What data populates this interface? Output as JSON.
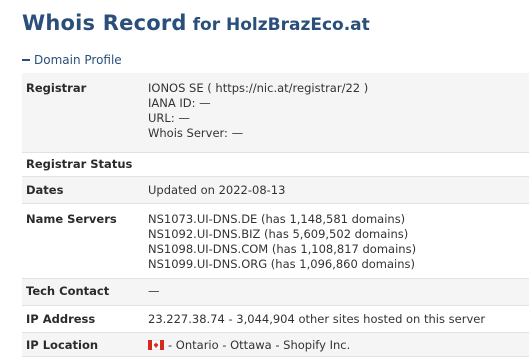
{
  "header": {
    "title": "Whois Record",
    "domain_prefix": "for HolzBrazEco.at"
  },
  "section": {
    "toggle_icon": "minus-icon",
    "label": "Domain Profile"
  },
  "registrar": {
    "label": "Registrar",
    "lines": [
      "IONOS SE ( https://nic.at/registrar/22 )",
      "IANA ID: —",
      "URL: —",
      "Whois Server: —"
    ]
  },
  "registrar_status": {
    "label": "Registrar Status",
    "value": ""
  },
  "dates": {
    "label": "Dates",
    "value": "Updated on 2022-08-13"
  },
  "name_servers": {
    "label": "Name Servers",
    "lines": [
      "NS1073.UI-DNS.DE (has 1,148,581 domains)",
      "NS1092.UI-DNS.BIZ (has 5,609,502 domains)",
      "NS1098.UI-DNS.COM (has 1,108,817 domains)",
      "NS1099.UI-DNS.ORG (has 1,096,860 domains)"
    ]
  },
  "tech_contact": {
    "label": "Tech Contact",
    "value": "—"
  },
  "ip_address": {
    "label": "IP Address",
    "value": "23.227.38.74 - 3,044,904 other sites hosted on this server"
  },
  "ip_location": {
    "label": "IP Location",
    "flag_icon": "canada-flag-icon",
    "value": "- Ontario - Ottawa - Shopify Inc."
  },
  "colors": {
    "title": "#2a4f7a",
    "shaded_row": "#f5f5f5",
    "flag_red": "#d52b1e"
  }
}
